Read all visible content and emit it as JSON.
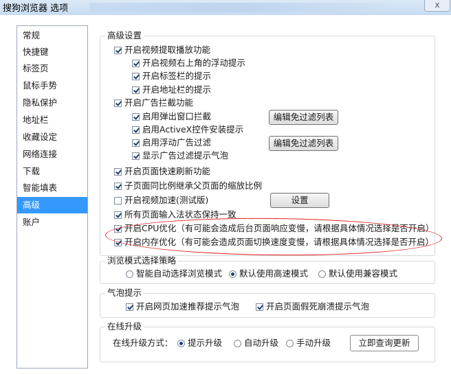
{
  "window": {
    "title": "搜狗浏览器 选项",
    "close_label": "x"
  },
  "sidebar": {
    "items": [
      {
        "label": "常规"
      },
      {
        "label": "快捷键"
      },
      {
        "label": "标签页"
      },
      {
        "label": "鼠标手势"
      },
      {
        "label": "隐私保护"
      },
      {
        "label": "地址栏"
      },
      {
        "label": "收藏设定"
      },
      {
        "label": "网络连接"
      },
      {
        "label": "下载"
      },
      {
        "label": "智能填表"
      },
      {
        "label": "高级",
        "active": true
      },
      {
        "label": "账户"
      }
    ]
  },
  "advanced": {
    "title": "高级设置",
    "video_extract": {
      "label": "开启视频提取播放功能",
      "checked": true
    },
    "video_float_tip": {
      "label": "开启视频右上角的浮动提示",
      "checked": true
    },
    "tab_tip": {
      "label": "开启标签栏的提示",
      "checked": true
    },
    "address_tip": {
      "label": "开启地址栏的提示",
      "checked": true
    },
    "ad_block": {
      "label": "开启广告拦截功能",
      "checked": true
    },
    "popup_block": {
      "label": "启用弹出窗口拦截",
      "checked": true
    },
    "activex_block": {
      "label": "启用ActiveX控件安装提示",
      "checked": true
    },
    "float_ad_filter": {
      "label": "启用浮动广告过滤",
      "checked": true
    },
    "ad_filter_tip": {
      "label": "显示广告过滤提示气泡",
      "checked": true
    },
    "edit_exempt_btn_1": "编辑免过滤列表",
    "edit_exempt_btn_2": "编辑免过滤列表",
    "fast_refresh": {
      "label": "开启页面快速刷新功能",
      "checked": true
    },
    "subpage_zoom": {
      "label": "子页面同比例继承父页面的缩放比例",
      "checked": true
    },
    "video_accel": {
      "label": "开启视频加速(测试版)",
      "checked": false
    },
    "settings_btn": "设置",
    "input_state": {
      "label": "所有页面输入法状态保持一致",
      "checked": true
    },
    "cpu_opt": {
      "label": "开启CPU优化（有可能会造成后台页面响应变慢，请根据具体情况选择是否开启）",
      "checked": true
    },
    "mem_opt": {
      "label": "开启内存优化（有可能会造成页面切换速度变慢，请根据具体情况选择是否开启）",
      "checked": true
    }
  },
  "browse_mode": {
    "title": "浏览模式选择策略",
    "options": [
      {
        "label": "智能自动选择浏览模式",
        "selected": false
      },
      {
        "label": "默认使用高速模式",
        "selected": true
      },
      {
        "label": "默认使用兼容模式",
        "selected": false
      }
    ]
  },
  "bubble": {
    "title": "气泡提示",
    "recommend": {
      "label": "开启网页加速推荐提示气泡",
      "checked": true
    },
    "crash": {
      "label": "开启页面假死崩溃提示气泡",
      "checked": true
    }
  },
  "online_upgrade": {
    "title": "在线升级",
    "method_label": "在线升级方式：",
    "options": [
      {
        "label": "提示升级",
        "selected": true
      },
      {
        "label": "自动升级",
        "selected": false
      },
      {
        "label": "手动升级",
        "selected": false
      }
    ],
    "check_btn": "立即查询更新"
  }
}
